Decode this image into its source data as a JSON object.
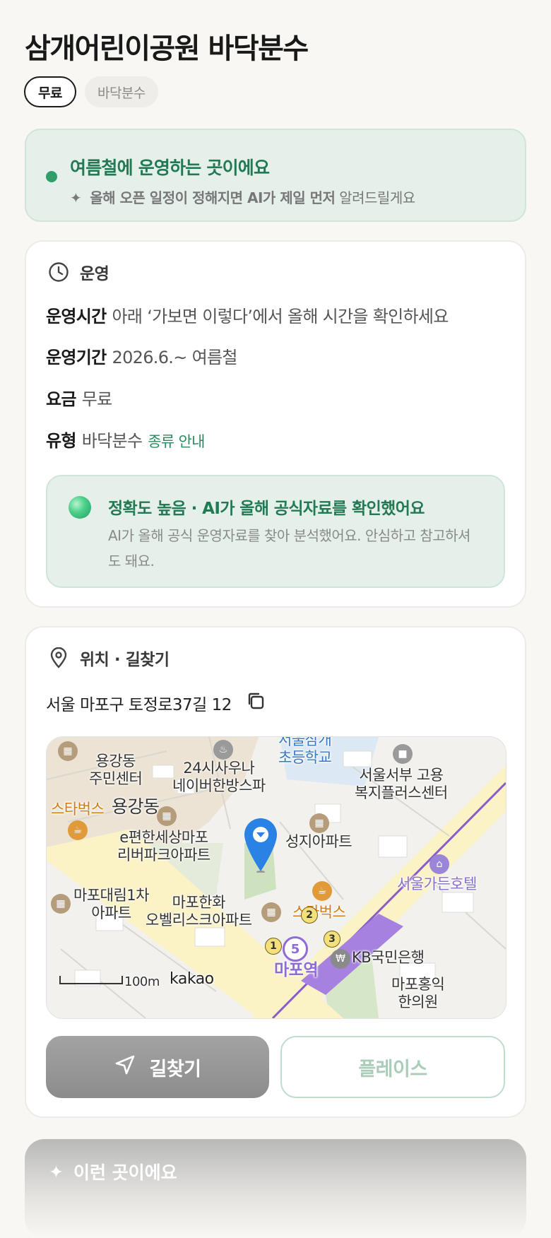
{
  "place": {
    "title": "삼개어린이공원 바닥분수",
    "chips": [
      "무료",
      "바닥분수"
    ]
  },
  "season_notice": {
    "headline": "여름철에 운영하는 곳이에요",
    "sub_bold": "올해 오픈 일정이 정해지면 AI가 제일 먼저",
    "sub_rest": " 알려드릴게요",
    "accent_color": "#217a53"
  },
  "operation": {
    "section_label": "운영",
    "icon": "clock-icon",
    "rows": [
      {
        "key": "운영시간",
        "value": "아래 ‘가보면 이렇다’에서 올해 시간을 확인하세요"
      },
      {
        "key": "운영기간",
        "value": "2026.6.~ 여름철"
      },
      {
        "key": "요금",
        "value": "무료"
      },
      {
        "key": "유형",
        "value": "바닥분수",
        "link": "종류 안내"
      }
    ],
    "accuracy": {
      "headline": "정확도 높음 · AI가 올해 공식자료를 확인했어요",
      "body": "AI가 올해 공식 운영자료를 찾아 분석했어요. 안심하고 참고하셔도 돼요."
    }
  },
  "location": {
    "section_label": "위치 · 길찾기",
    "icon": "map-pin-icon",
    "address": "서울 마포구 토정로37길 12",
    "map": {
      "labels": {
        "yonggang_center": "용강동\n주민센터",
        "sauna": "24시사우나\n네이버한방스파",
        "school": "서울삼개\n초등학교",
        "employment": "서울서부 고용\n복지플러스센터",
        "starbucks1": "스타벅스",
        "yonggang": "용강동",
        "riverpark": "e편한세상마포\n리버파크아파트",
        "seongji": "성지아파트",
        "hotel": "서울가든호텔",
        "daerim": "마포대림1차\n아파트",
        "hanhwa": "마포한화\n오벨리스크아파트",
        "starbucks2": "스타벅스",
        "kb": "KB국민은행",
        "hongik": "마포홍익\n한의원",
        "station": "마포역",
        "scale": "100m",
        "brand": "kakao",
        "exit1": "1",
        "exit2": "2",
        "exit3": "3",
        "line": "5"
      }
    },
    "buttons": {
      "directions": "길찾기",
      "place": "플레이스"
    }
  },
  "next_section": {
    "label": "이런 곳이에요"
  }
}
